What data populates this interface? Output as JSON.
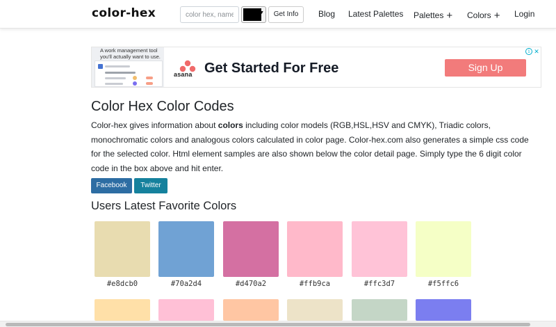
{
  "brand": "color-hex",
  "search": {
    "placeholder": "color hex, name",
    "button_label": "Get Info",
    "picker_color": "#000000"
  },
  "nav": {
    "blog": "Blog",
    "latest": "Latest Palettes",
    "palettes": "Palettes",
    "colors": "Colors",
    "login": "Login"
  },
  "ad": {
    "tagline": "A work management tool you'll actually want to use.",
    "brand": "asana",
    "headline": "Get Started For Free",
    "cta": "Sign Up",
    "info_icon": "info-icon",
    "close_icon": "close-icon"
  },
  "page": {
    "title": "Color Hex Color Codes",
    "intro_pre": "Color-hex gives information about ",
    "intro_bold": "colors",
    "intro_post": " including color models (RGB,HSL,HSV and CMYK), Triadic colors, monochromatic colors and analogous colors calculated in color page. Color-hex.com also generates a simple css code for the selected color. Html element samples are also shown below the color detail page. Simply type the 6 digit color code in the box above and hit enter.",
    "facebook": "Facebook",
    "twitter": "Twitter",
    "section_title": "Users Latest Favorite Colors"
  },
  "favorite_colors": [
    {
      "hex": "#e8dcb0",
      "label": "#e8dcb0"
    },
    {
      "hex": "#70a2d4",
      "label": "#70a2d4"
    },
    {
      "hex": "#d470a2",
      "label": "#d470a2"
    },
    {
      "hex": "#ffb9ca",
      "label": "#ffb9ca"
    },
    {
      "hex": "#ffc3d7",
      "label": "#ffc3d7"
    },
    {
      "hex": "#f5ffc6",
      "label": "#f5ffc6"
    }
  ],
  "favorite_colors_row2": [
    {
      "hex": "#ffe0a8"
    },
    {
      "hex": "#ffc0d6"
    },
    {
      "hex": "#ffc6a3"
    },
    {
      "hex": "#ede3c8"
    },
    {
      "hex": "#c4d6c6"
    },
    {
      "hex": "#7b7ef0"
    }
  ]
}
